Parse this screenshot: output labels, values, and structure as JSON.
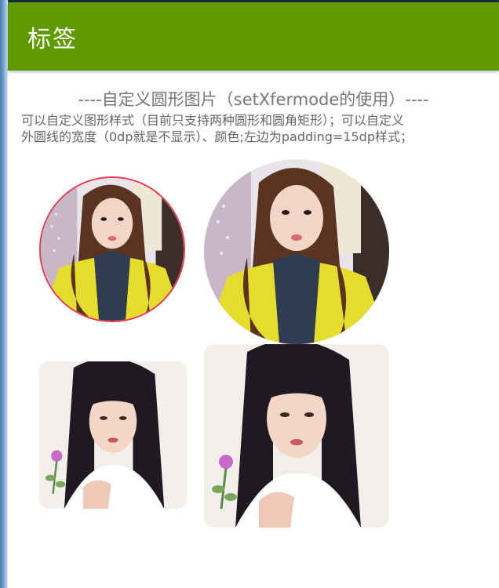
{
  "app_bar": {
    "title": "标签",
    "color": "#5f9a00"
  },
  "content": {
    "heading": "----自定义圆形图片（setXfermode的使用）----",
    "description_line1": "可以自定义图形样式（目前只支持两种圆形和圆角矩形）；可以自定义",
    "description_line2": "外圆线的宽度（0dp就是不显示）、颜色;左边为padding=15dp样式；"
  },
  "images": [
    {
      "shape": "circle",
      "border_color": "#e8384c",
      "subject": "girl-yellow-shirt-photo"
    },
    {
      "shape": "circle",
      "border_color": "none",
      "subject": "girl-yellow-shirt-photo"
    },
    {
      "shape": "rounded-rectangle",
      "subject": "woman-white-robe-photo"
    },
    {
      "shape": "rounded-rectangle",
      "subject": "woman-white-robe-photo"
    }
  ]
}
